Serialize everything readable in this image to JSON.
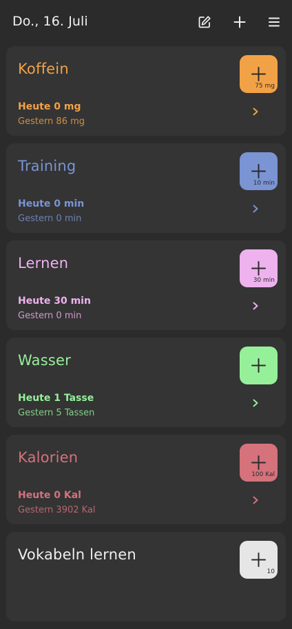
{
  "header": {
    "date": "Do., 16. Juli",
    "icons": [
      "edit-icon",
      "plus-icon",
      "menu-icon"
    ]
  },
  "cards": [
    {
      "title": "Koffein",
      "today": "Heute 0 mg",
      "yesterday": "Gestern 86 mg",
      "add_amount": "75 mg",
      "color": "#f2a246",
      "button_color": "#f2a246"
    },
    {
      "title": "Training",
      "today": "Heute 0 min",
      "yesterday": "Gestern 0 min",
      "add_amount": "10 min",
      "color": "#7a94d4",
      "button_color": "#7a94d4"
    },
    {
      "title": "Lernen",
      "today": "Heute 30 min",
      "yesterday": "Gestern 0 min",
      "add_amount": "30 min",
      "color": "#eeb2ee",
      "button_color": "#eeb2ee"
    },
    {
      "title": "Wasser",
      "today": "Heute 1 Tasse",
      "yesterday": "Gestern 5 Tassen",
      "add_amount": "",
      "color": "#96f09a",
      "button_color": "#96f09a"
    },
    {
      "title": "Kalorien",
      "today": "Heute 0 Kal",
      "yesterday": "Gestern 3902 Kal",
      "add_amount": "100 Kal",
      "color": "#d5727c",
      "button_color": "#d5727c"
    },
    {
      "title": "Vokabeln lernen",
      "today": "",
      "yesterday": "",
      "add_amount": "10",
      "color": "#eeeeee",
      "button_color": "#e6e6e6"
    }
  ]
}
